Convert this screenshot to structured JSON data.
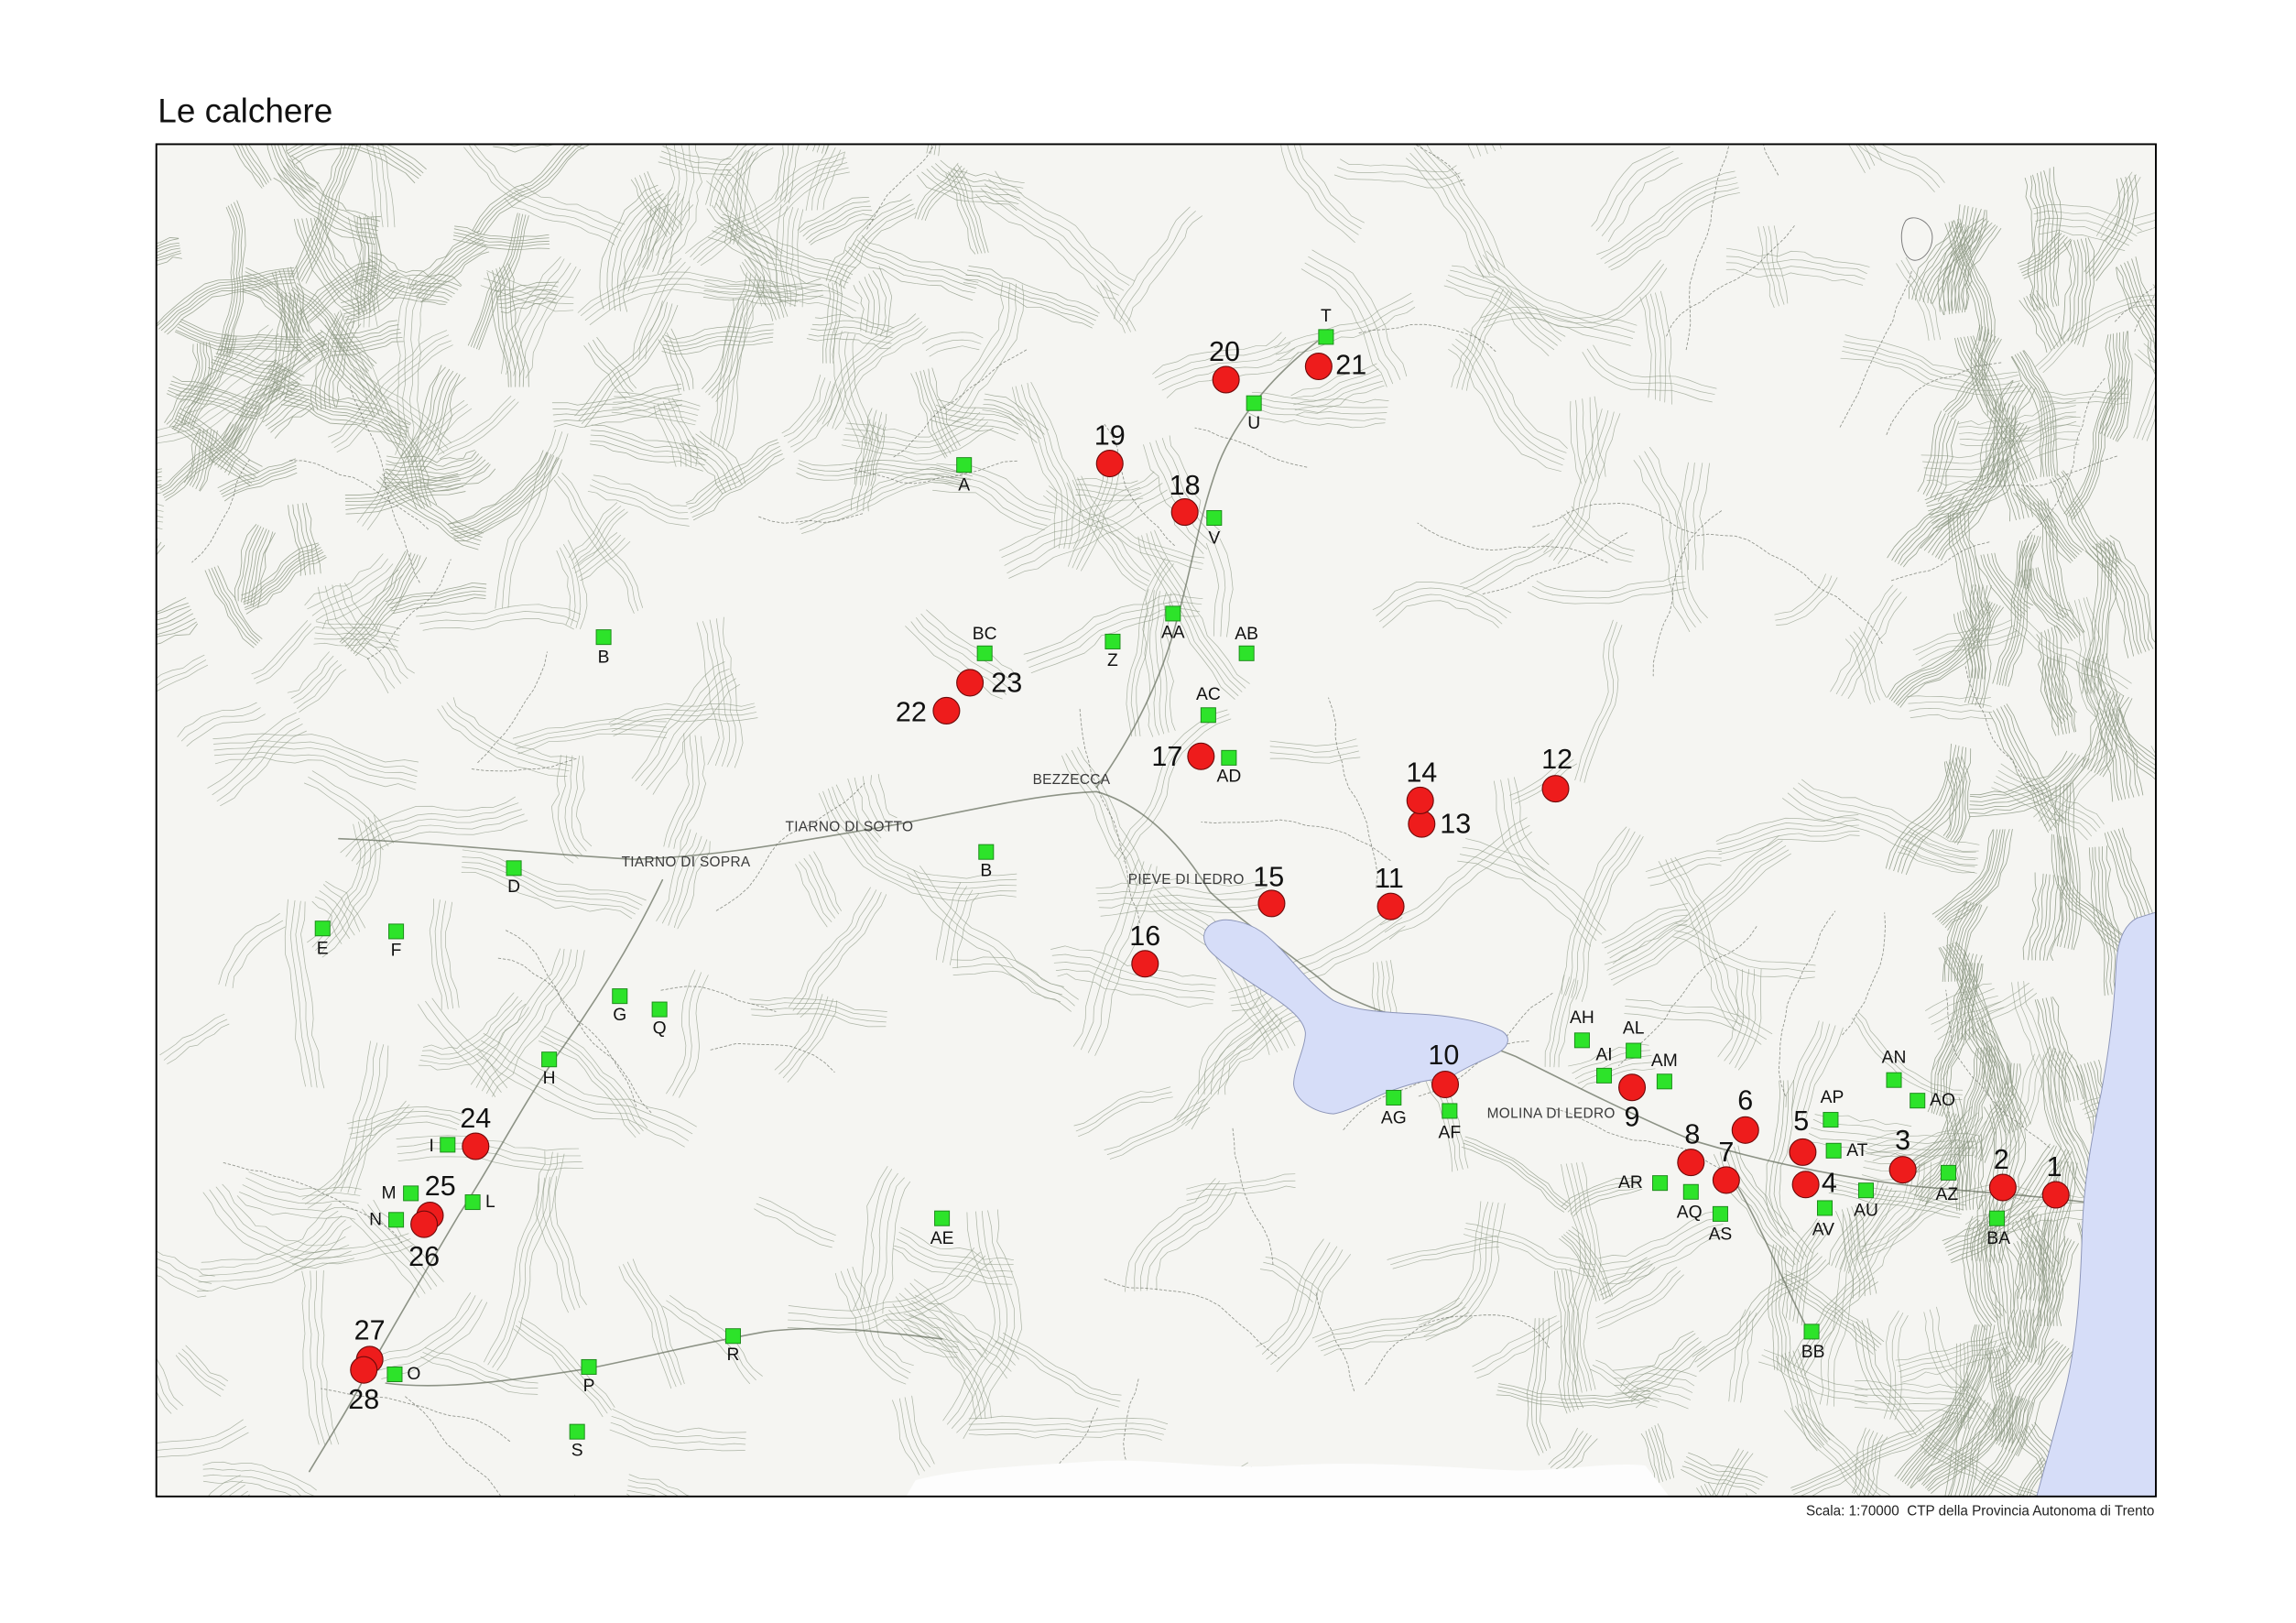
{
  "title": "Le calchere",
  "footer": "Scala: 1:70000  CTP della Provincia Autonoma di Trento",
  "place_names": {
    "tiarno_di_sopra": "TIARNO DI SOPRA",
    "tiarno_di_sotto": "TIARNO DI SOTTO",
    "bezzecca": "BEZZECCA",
    "pieve_di_ledro": "PIEVE DI LEDRO",
    "molina_di_ledro": "MOLINA DI LEDRO"
  },
  "kilns": [
    "1",
    "2",
    "3",
    "4",
    "5",
    "6",
    "7",
    "8",
    "9",
    "10",
    "11",
    "12",
    "13",
    "14",
    "15",
    "16",
    "17",
    "18",
    "19",
    "20",
    "21",
    "22",
    "23",
    "24",
    "25",
    "26",
    "27",
    "28"
  ],
  "sites": [
    "T",
    "U",
    "A",
    "V",
    "AA",
    "Z",
    "AB",
    "BC",
    "B",
    "AC",
    "AD",
    "B",
    "D",
    "E",
    "F",
    "G",
    "Q",
    "H",
    "I",
    "M",
    "L",
    "N",
    "AE",
    "O",
    "P",
    "R",
    "S",
    "AG",
    "AF",
    "AH",
    "AL",
    "AI",
    "AM",
    "AN",
    "AO",
    "AP",
    "AT",
    "AR",
    "AQ",
    "AS",
    "AV",
    "AU",
    "AZ",
    "BA",
    "BB"
  ],
  "colors": {
    "kiln_marker": "#ee1c1c",
    "site_marker": "#2de32a",
    "water": "#d6ddf8"
  }
}
